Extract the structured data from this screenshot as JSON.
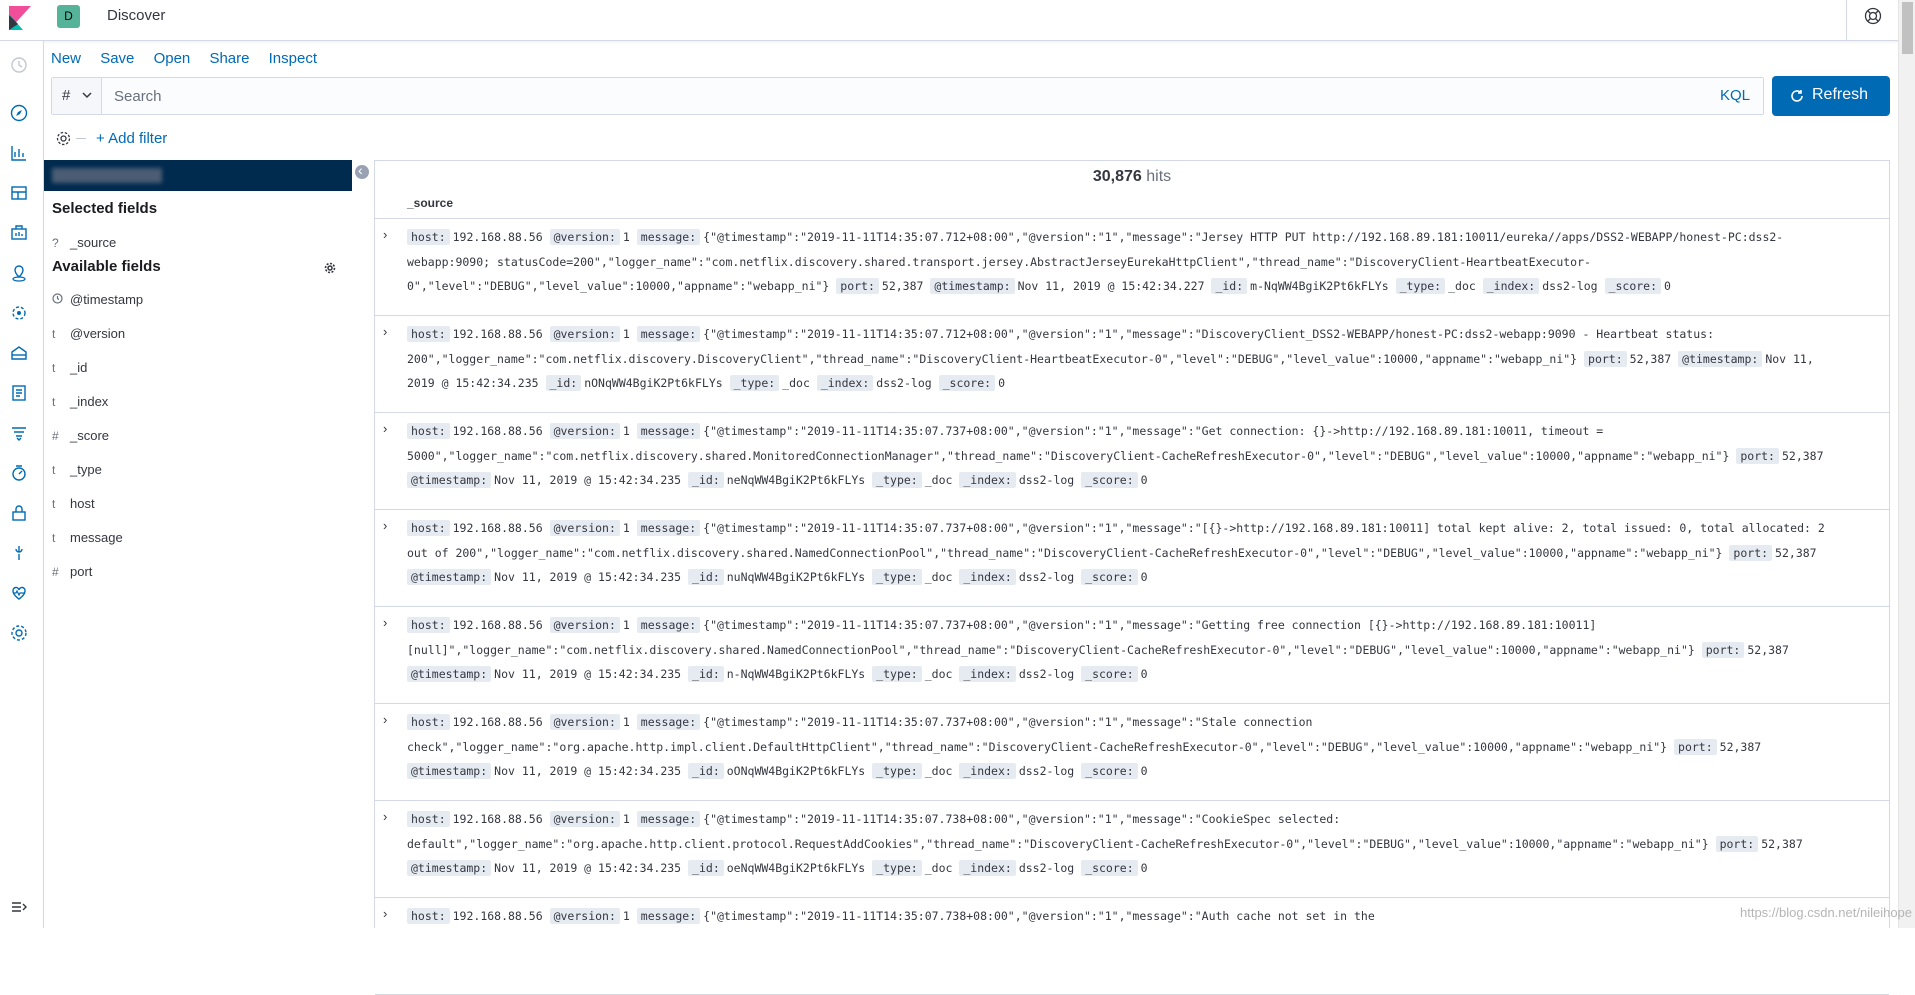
{
  "topbar": {
    "space_initial": "D",
    "app_title": "Discover"
  },
  "menu": {
    "new": "New",
    "save": "Save",
    "open": "Open",
    "share": "Share",
    "inspect": "Inspect"
  },
  "query": {
    "lang_symbol": "#",
    "placeholder": "Search",
    "language": "KQL",
    "refresh_label": "Refresh"
  },
  "filter": {
    "add_filter": "+ Add filter"
  },
  "sidebar": {
    "selected_title": "Selected fields",
    "selected": [
      {
        "type": "?",
        "name": "_source"
      }
    ],
    "available_title": "Available fields",
    "available": [
      {
        "type": "clock",
        "name": "@timestamp"
      },
      {
        "type": "t",
        "name": "@version"
      },
      {
        "type": "t",
        "name": "_id"
      },
      {
        "type": "t",
        "name": "_index"
      },
      {
        "type": "#",
        "name": "_score"
      },
      {
        "type": "t",
        "name": "_type"
      },
      {
        "type": "t",
        "name": "host"
      },
      {
        "type": "t",
        "name": "message"
      },
      {
        "type": "#",
        "name": "port"
      }
    ]
  },
  "results": {
    "hits_count": "30,876",
    "hits_label": "hits",
    "column_header": "_source",
    "docs": [
      {
        "lines": [
          [
            [
              "k",
              "host:"
            ],
            [
              "v",
              "192.168.88.56"
            ],
            [
              "k",
              "@version:"
            ],
            [
              "v",
              "1"
            ],
            [
              "k",
              "message:"
            ],
            [
              "v",
              "{\"@timestamp\":\"2019-11-11T14:35:07.712+08:00\",\"@version\":\"1\",\"message\":\"Jersey HTTP PUT http://192.168.89.181:10011/eureka//apps/DSS2-WEBAPP/honest-PC:dss2-"
            ]
          ],
          [
            [
              "v",
              "webapp:9090; statusCode=200\",\"logger_name\":\"com.netflix.discovery.shared.transport.jersey.AbstractJerseyEurekaHttpClient\",\"thread_name\":\"DiscoveryClient-HeartbeatExecutor-"
            ]
          ],
          [
            [
              "v",
              "0\",\"level\":\"DEBUG\",\"level_value\":10000,\"appname\":\"webapp_ni\"}"
            ],
            [
              "k",
              "port:"
            ],
            [
              "v",
              "52,387"
            ],
            [
              "k",
              "@timestamp:"
            ],
            [
              "v",
              "Nov 11, 2019 @ 15:42:34.227"
            ],
            [
              "k",
              "_id:"
            ],
            [
              "v",
              "m-NqWW4BgiK2Pt6kFLYs"
            ],
            [
              "k",
              "_type:"
            ],
            [
              "v",
              "_doc"
            ],
            [
              "k",
              "_index:"
            ],
            [
              "v",
              "dss2-log"
            ],
            [
              "k",
              "_score:"
            ],
            [
              "v",
              "0"
            ]
          ]
        ]
      },
      {
        "lines": [
          [
            [
              "k",
              "host:"
            ],
            [
              "v",
              "192.168.88.56"
            ],
            [
              "k",
              "@version:"
            ],
            [
              "v",
              "1"
            ],
            [
              "k",
              "message:"
            ],
            [
              "v",
              "{\"@timestamp\":\"2019-11-11T14:35:07.712+08:00\",\"@version\":\"1\",\"message\":\"DiscoveryClient_DSS2-WEBAPP/honest-PC:dss2-webapp:9090 - Heartbeat status:"
            ]
          ],
          [
            [
              "v",
              "200\",\"logger_name\":\"com.netflix.discovery.DiscoveryClient\",\"thread_name\":\"DiscoveryClient-HeartbeatExecutor-0\",\"level\":\"DEBUG\",\"level_value\":10000,\"appname\":\"webapp_ni\"}"
            ],
            [
              "k",
              "port:"
            ],
            [
              "v",
              "52,387"
            ],
            [
              "k",
              "@timestamp:"
            ],
            [
              "v",
              "Nov 11,"
            ]
          ],
          [
            [
              "v",
              "2019 @ 15:42:34.235"
            ],
            [
              "k",
              "_id:"
            ],
            [
              "v",
              "nONqWW4BgiK2Pt6kFLYs"
            ],
            [
              "k",
              "_type:"
            ],
            [
              "v",
              "_doc"
            ],
            [
              "k",
              "_index:"
            ],
            [
              "v",
              "dss2-log"
            ],
            [
              "k",
              "_score:"
            ],
            [
              "v",
              "0"
            ]
          ]
        ]
      },
      {
        "lines": [
          [
            [
              "k",
              "host:"
            ],
            [
              "v",
              "192.168.88.56"
            ],
            [
              "k",
              "@version:"
            ],
            [
              "v",
              "1"
            ],
            [
              "k",
              "message:"
            ],
            [
              "v",
              "{\"@timestamp\":\"2019-11-11T14:35:07.737+08:00\",\"@version\":\"1\",\"message\":\"Get connection: {}->http://192.168.89.181:10011, timeout ="
            ]
          ],
          [
            [
              "v",
              "5000\",\"logger_name\":\"com.netflix.discovery.shared.MonitoredConnectionManager\",\"thread_name\":\"DiscoveryClient-CacheRefreshExecutor-0\",\"level\":\"DEBUG\",\"level_value\":10000,\"appname\":\"webapp_ni\"}"
            ],
            [
              "k",
              "port:"
            ],
            [
              "v",
              "52,387"
            ]
          ],
          [
            [
              "k",
              "@timestamp:"
            ],
            [
              "v",
              "Nov 11, 2019 @ 15:42:34.235"
            ],
            [
              "k",
              "_id:"
            ],
            [
              "v",
              "neNqWW4BgiK2Pt6kFLYs"
            ],
            [
              "k",
              "_type:"
            ],
            [
              "v",
              "_doc"
            ],
            [
              "k",
              "_index:"
            ],
            [
              "v",
              "dss2-log"
            ],
            [
              "k",
              "_score:"
            ],
            [
              "v",
              "0"
            ]
          ]
        ]
      },
      {
        "lines": [
          [
            [
              "k",
              "host:"
            ],
            [
              "v",
              "192.168.88.56"
            ],
            [
              "k",
              "@version:"
            ],
            [
              "v",
              "1"
            ],
            [
              "k",
              "message:"
            ],
            [
              "v",
              "{\"@timestamp\":\"2019-11-11T14:35:07.737+08:00\",\"@version\":\"1\",\"message\":\"[{}->http://192.168.89.181:10011] total kept alive: 2, total issued: 0, total allocated: 2"
            ]
          ],
          [
            [
              "v",
              "out of 200\",\"logger_name\":\"com.netflix.discovery.shared.NamedConnectionPool\",\"thread_name\":\"DiscoveryClient-CacheRefreshExecutor-0\",\"level\":\"DEBUG\",\"level_value\":10000,\"appname\":\"webapp_ni\"}"
            ],
            [
              "k",
              "port:"
            ],
            [
              "v",
              "52,387"
            ]
          ],
          [
            [
              "k",
              "@timestamp:"
            ],
            [
              "v",
              "Nov 11, 2019 @ 15:42:34.235"
            ],
            [
              "k",
              "_id:"
            ],
            [
              "v",
              "nuNqWW4BgiK2Pt6kFLYs"
            ],
            [
              "k",
              "_type:"
            ],
            [
              "v",
              "_doc"
            ],
            [
              "k",
              "_index:"
            ],
            [
              "v",
              "dss2-log"
            ],
            [
              "k",
              "_score:"
            ],
            [
              "v",
              "0"
            ]
          ]
        ]
      },
      {
        "lines": [
          [
            [
              "k",
              "host:"
            ],
            [
              "v",
              "192.168.88.56"
            ],
            [
              "k",
              "@version:"
            ],
            [
              "v",
              "1"
            ],
            [
              "k",
              "message:"
            ],
            [
              "v",
              "{\"@timestamp\":\"2019-11-11T14:35:07.737+08:00\",\"@version\":\"1\",\"message\":\"Getting free connection [{}->http://192.168.89.181:10011]"
            ]
          ],
          [
            [
              "v",
              "[null]\",\"logger_name\":\"com.netflix.discovery.shared.NamedConnectionPool\",\"thread_name\":\"DiscoveryClient-CacheRefreshExecutor-0\",\"level\":\"DEBUG\",\"level_value\":10000,\"appname\":\"webapp_ni\"}"
            ],
            [
              "k",
              "port:"
            ],
            [
              "v",
              "52,387"
            ]
          ],
          [
            [
              "k",
              "@timestamp:"
            ],
            [
              "v",
              "Nov 11, 2019 @ 15:42:34.235"
            ],
            [
              "k",
              "_id:"
            ],
            [
              "v",
              "n-NqWW4BgiK2Pt6kFLYs"
            ],
            [
              "k",
              "_type:"
            ],
            [
              "v",
              "_doc"
            ],
            [
              "k",
              "_index:"
            ],
            [
              "v",
              "dss2-log"
            ],
            [
              "k",
              "_score:"
            ],
            [
              "v",
              "0"
            ]
          ]
        ]
      },
      {
        "lines": [
          [
            [
              "k",
              "host:"
            ],
            [
              "v",
              "192.168.88.56"
            ],
            [
              "k",
              "@version:"
            ],
            [
              "v",
              "1"
            ],
            [
              "k",
              "message:"
            ],
            [
              "v",
              "{\"@timestamp\":\"2019-11-11T14:35:07.737+08:00\",\"@version\":\"1\",\"message\":\"Stale connection"
            ]
          ],
          [
            [
              "v",
              "check\",\"logger_name\":\"org.apache.http.impl.client.DefaultHttpClient\",\"thread_name\":\"DiscoveryClient-CacheRefreshExecutor-0\",\"level\":\"DEBUG\",\"level_value\":10000,\"appname\":\"webapp_ni\"}"
            ],
            [
              "k",
              "port:"
            ],
            [
              "v",
              "52,387"
            ]
          ],
          [
            [
              "k",
              "@timestamp:"
            ],
            [
              "v",
              "Nov 11, 2019 @ 15:42:34.235"
            ],
            [
              "k",
              "_id:"
            ],
            [
              "v",
              "oONqWW4BgiK2Pt6kFLYs"
            ],
            [
              "k",
              "_type:"
            ],
            [
              "v",
              "_doc"
            ],
            [
              "k",
              "_index:"
            ],
            [
              "v",
              "dss2-log"
            ],
            [
              "k",
              "_score:"
            ],
            [
              "v",
              "0"
            ]
          ]
        ]
      },
      {
        "lines": [
          [
            [
              "k",
              "host:"
            ],
            [
              "v",
              "192.168.88.56"
            ],
            [
              "k",
              "@version:"
            ],
            [
              "v",
              "1"
            ],
            [
              "k",
              "message:"
            ],
            [
              "v",
              "{\"@timestamp\":\"2019-11-11T14:35:07.738+08:00\",\"@version\":\"1\",\"message\":\"CookieSpec selected:"
            ]
          ],
          [
            [
              "v",
              "default\",\"logger_name\":\"org.apache.http.client.protocol.RequestAddCookies\",\"thread_name\":\"DiscoveryClient-CacheRefreshExecutor-0\",\"level\":\"DEBUG\",\"level_value\":10000,\"appname\":\"webapp_ni\"}"
            ],
            [
              "k",
              "port:"
            ],
            [
              "v",
              "52,387"
            ]
          ],
          [
            [
              "k",
              "@timestamp:"
            ],
            [
              "v",
              "Nov 11, 2019 @ 15:42:34.235"
            ],
            [
              "k",
              "_id:"
            ],
            [
              "v",
              "oeNqWW4BgiK2Pt6kFLYs"
            ],
            [
              "k",
              "_type:"
            ],
            [
              "v",
              "_doc"
            ],
            [
              "k",
              "_index:"
            ],
            [
              "v",
              "dss2-log"
            ],
            [
              "k",
              "_score:"
            ],
            [
              "v",
              "0"
            ]
          ]
        ]
      },
      {
        "lines": [
          [
            [
              "k",
              "host:"
            ],
            [
              "v",
              "192.168.88.56"
            ],
            [
              "k",
              "@version:"
            ],
            [
              "v",
              "1"
            ],
            [
              "k",
              "message:"
            ],
            [
              "v",
              "{\"@timestamp\":\"2019-11-11T14:35:07.738+08:00\",\"@version\":\"1\",\"message\":\"Auth cache not set in the"
            ]
          ]
        ]
      }
    ]
  },
  "watermark": "https://blog.csdn.net/nileihope"
}
